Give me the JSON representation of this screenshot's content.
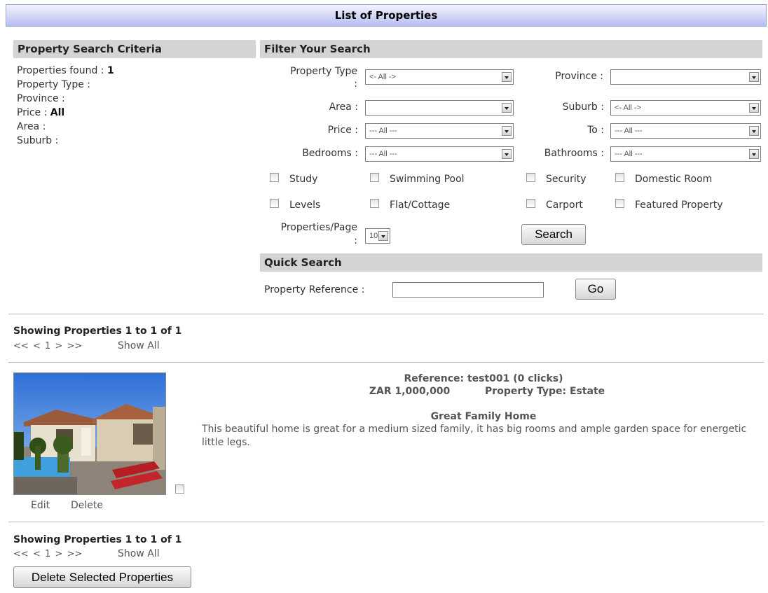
{
  "header": {
    "title": "List of Properties"
  },
  "criteria": {
    "heading": "Property Search Criteria",
    "found_label": "Properties found :",
    "found_value": "1",
    "type_label": "Property Type :",
    "province_label": "Province :",
    "price_label": "Price :",
    "price_value": "All",
    "area_label": "Area :",
    "suburb_label": "Suburb :"
  },
  "filter": {
    "heading": "Filter Your Search",
    "property_type": {
      "label_line1": "Property Type",
      "label_line2": ":",
      "value": "<- All ->"
    },
    "province": {
      "label": "Province :",
      "value": ""
    },
    "area": {
      "label": "Area :",
      "value": ""
    },
    "suburb": {
      "label": "Suburb :",
      "value": "<- All ->"
    },
    "price": {
      "label": "Price :",
      "value": "--- All ---"
    },
    "to": {
      "label": "To :",
      "value": "--- All ---"
    },
    "bedrooms": {
      "label": "Bedrooms :",
      "value": "--- All ---"
    },
    "bathrooms": {
      "label": "Bathrooms :",
      "value": "--- All ---"
    },
    "features": [
      "Study",
      "Swimming Pool",
      "Security",
      "Domestic Room",
      "Levels",
      "Flat/Cottage",
      "Carport",
      "Featured Property"
    ],
    "per_page": {
      "label_line1": "Properties/Page",
      "label_line2": ":",
      "value": "10"
    },
    "search_label": "Search"
  },
  "quick": {
    "heading": "Quick Search",
    "reference_label": "Property Reference :",
    "reference_value": "",
    "go_label": "Go"
  },
  "results": {
    "showing": "Showing Properties 1 to 1 of 1",
    "pager": [
      "<<",
      "<",
      "1",
      ">",
      ">>"
    ],
    "show_all": "Show All"
  },
  "listing": {
    "reference": "Reference: test001 (0 clicks)",
    "price": "ZAR 1,000,000",
    "property_type": "Property Type: Estate",
    "title": "Great Family Home",
    "description": "This beautiful home is great for a medium sized family, it has big rooms and ample garden space for energetic little legs.",
    "edit_label": "Edit",
    "delete_label": "Delete"
  },
  "footer": {
    "delete_selected_label": "Delete Selected Properties"
  }
}
